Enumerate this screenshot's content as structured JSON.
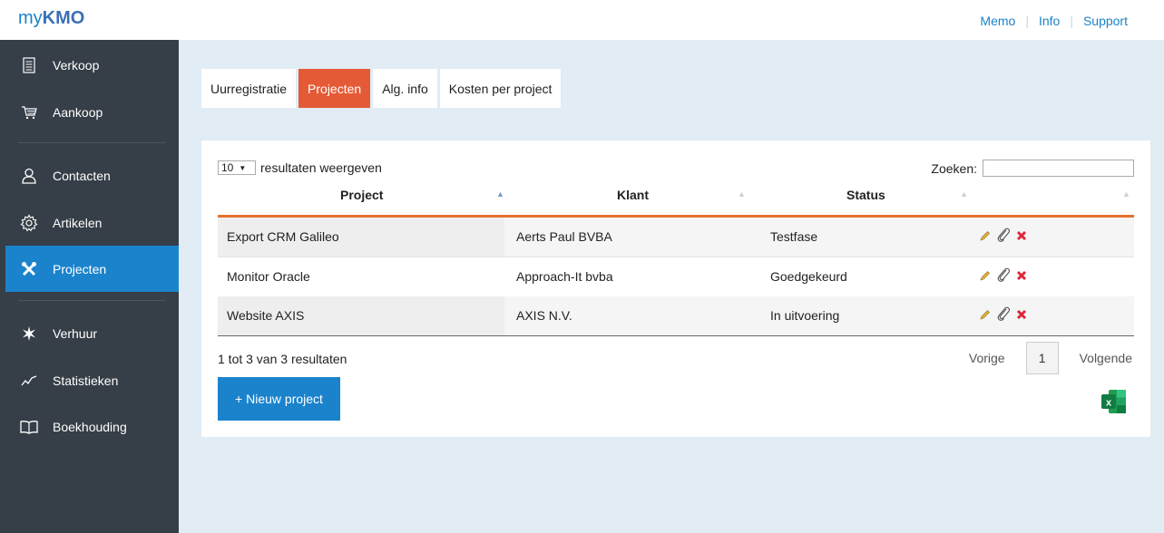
{
  "header": {
    "logo_my": "my",
    "logo_kmo": "KMO",
    "links": [
      {
        "label": "Memo"
      },
      {
        "label": "Info"
      },
      {
        "label": "Support"
      }
    ],
    "separator": "|"
  },
  "sidebar": {
    "items": [
      {
        "label": "Verkoop",
        "icon": "document-icon"
      },
      {
        "label": "Aankoop",
        "icon": "cart-icon"
      },
      {
        "label": "Contacten",
        "icon": "person-icon"
      },
      {
        "label": "Artikelen",
        "icon": "gear-icon"
      },
      {
        "label": "Projecten",
        "icon": "tools-icon",
        "active": true
      },
      {
        "label": "Verhuur",
        "icon": "star-icon"
      },
      {
        "label": "Statistieken",
        "icon": "chart-line-icon"
      },
      {
        "label": "Boekhouding",
        "icon": "book-icon"
      }
    ]
  },
  "tabs": [
    {
      "label": "Uurregistratie"
    },
    {
      "label": "Projecten",
      "active": true
    },
    {
      "label": "Alg. info"
    },
    {
      "label": "Kosten per project"
    }
  ],
  "table": {
    "length_value": "10",
    "length_label": "resultaten weergeven",
    "search_label": "Zoeken:",
    "search_value": "",
    "columns": [
      "Project",
      "Klant",
      "Status"
    ],
    "rows": [
      {
        "project": "Export CRM Galileo",
        "klant": "Aerts Paul BVBA",
        "status": "Testfase"
      },
      {
        "project": "Monitor Oracle",
        "klant": "Approach-It bvba",
        "status": "Goedgekeurd"
      },
      {
        "project": "Website AXIS",
        "klant": "AXIS N.V.",
        "status": "In uitvoering"
      }
    ],
    "info": "1 tot 3 van 3 resultaten",
    "prev_label": "Vorige",
    "current_page": "1",
    "next_label": "Volgende"
  },
  "actions": {
    "new_project_label": "+ Nieuw project",
    "excel_letter": "x"
  },
  "colors": {
    "accent_blue": "#1b83cc",
    "accent_orange": "#e55a36",
    "sidebar_bg": "#363e47",
    "delete_red": "#e0263a"
  }
}
